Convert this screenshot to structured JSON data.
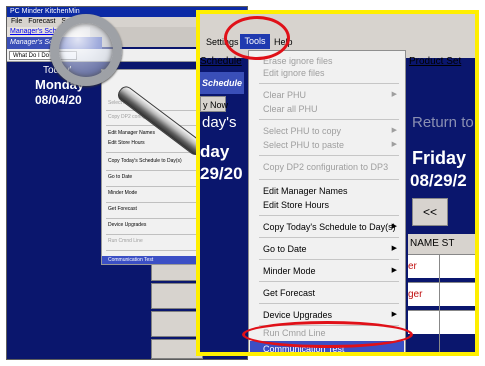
{
  "background_window": {
    "title": "PC Minder KitchenMin",
    "menu": [
      "File",
      "Forecast",
      "Sett"
    ],
    "tab_link": "Manager's Sch",
    "tab_active": "Manager's Sch",
    "wdidn_button": "What Do I Do No",
    "todays_label": "Today'",
    "day": "Monday",
    "date": "08/04/20",
    "menu_items": [
      {
        "label": "Select PHU to c",
        "enabled": false
      },
      {
        "label": "Copy DP2 configurati",
        "enabled": false
      },
      {
        "label": "Edit Manager Names",
        "enabled": true
      },
      {
        "label": "Edit Store Hours",
        "enabled": true
      },
      {
        "label": "Copy Today's Schedule to Day(s)",
        "enabled": true,
        "submenu": true
      },
      {
        "label": "Go to Date",
        "enabled": true
      },
      {
        "label": "Minder Mode",
        "enabled": true
      },
      {
        "label": "Get Forecast",
        "enabled": true
      },
      {
        "label": "Device Upgrades",
        "enabled": true
      },
      {
        "label": "Run Cmnd Line",
        "enabled": false
      },
      {
        "label": "Communication Test",
        "enabled": true,
        "highlighted": true
      }
    ]
  },
  "zoom": {
    "menubar": {
      "settings": "Settings",
      "tools": "Tools",
      "help": "Help"
    },
    "schedule_link": "Schedule",
    "product_link": "Product Set",
    "schedule_tab": "Schedule",
    "now_button": "y Now",
    "todays_label": "day's",
    "return_label": "Return to",
    "day": "day",
    "date": "29/20",
    "friday": "Friday",
    "friday_date": "08/29/2",
    "prev_button": "<<",
    "name_header": "NAME ST",
    "grid_values": [
      "er",
      "ger",
      ""
    ],
    "dropdown": [
      {
        "label": "Erase ignore files",
        "enabled": false
      },
      {
        "label": "Edit ignore files",
        "enabled": false
      },
      {
        "label": "Clear PHU",
        "enabled": false,
        "submenu": true
      },
      {
        "label": "Clear all PHU",
        "enabled": false
      },
      {
        "label": "Select PHU to copy",
        "enabled": false,
        "submenu": true
      },
      {
        "label": "Select PHU to paste",
        "enabled": false,
        "submenu": true
      },
      {
        "label": "Copy DP2 configuration to DP3",
        "enabled": false
      },
      {
        "label": "Edit Manager Names",
        "enabled": true
      },
      {
        "label": "Edit Store Hours",
        "enabled": true
      },
      {
        "label": "Copy Today's Schedule to Day(s)",
        "enabled": true,
        "submenu": true
      },
      {
        "label": "Go to Date",
        "enabled": true,
        "submenu": true
      },
      {
        "label": "Minder Mode",
        "enabled": true,
        "submenu": true
      },
      {
        "label": "Get Forecast",
        "enabled": true
      },
      {
        "label": "Device Upgrades",
        "enabled": true,
        "submenu": true
      },
      {
        "label": "Run Cmnd Line",
        "enabled": false
      },
      {
        "label": "Communication Test",
        "enabled": true,
        "highlighted": true
      }
    ]
  },
  "colors": {
    "window_bg": "#0a166d",
    "highlight": "#ffef00",
    "annotation": "#e01018",
    "menu_selected": "#3b4fc5"
  },
  "icons": {
    "magnifier": "magnifier-icon",
    "submenu_arrow": "chevron-right-icon"
  }
}
